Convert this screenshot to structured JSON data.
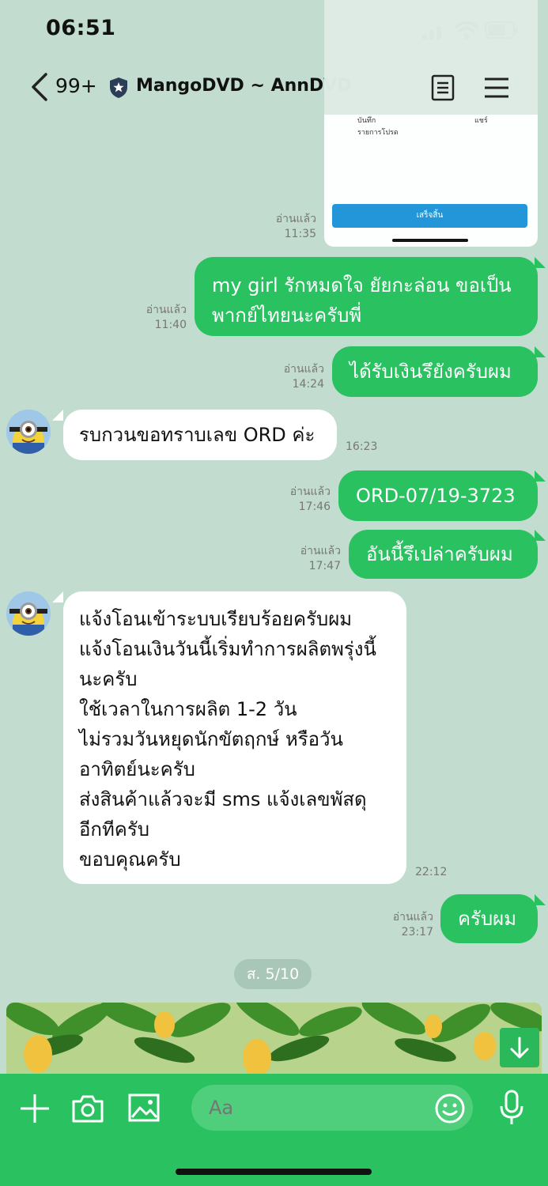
{
  "status_bar": {
    "time": "06:51"
  },
  "header": {
    "back_count": "99+",
    "chat_title": "MangoDVD ~ AnnDVD"
  },
  "shared_image": {
    "label_a": "บันทึก",
    "label_b": "แชร์",
    "label_c": "รายการโปรด",
    "button": "เสร็จสิ้น"
  },
  "messages": [
    {
      "dir": "out",
      "read": "อ่านแล้ว",
      "time": "11:35"
    },
    {
      "dir": "out",
      "read": "อ่านแล้ว",
      "time": "11:40",
      "lines": [
        "my girl รักหมดใจ ยัยกะล่อน ขอเป็น",
        "พากย์ไทยนะครับพี่"
      ]
    },
    {
      "dir": "out",
      "read": "อ่านแล้ว",
      "time": "14:24",
      "lines": [
        "ได้รับเงินรึยังครับผม"
      ]
    },
    {
      "dir": "in",
      "time": "16:23",
      "lines": [
        "รบกวนขอทราบเลข ORD ค่ะ"
      ]
    },
    {
      "dir": "out",
      "read": "อ่านแล้ว",
      "time": "17:46",
      "lines": [
        "ORD-07/19-3723"
      ]
    },
    {
      "dir": "out",
      "read": "อ่านแล้ว",
      "time": "17:47",
      "lines": [
        "อันนี้รึเปล่าครับผม"
      ]
    },
    {
      "dir": "in",
      "time": "22:12",
      "lines": [
        "แจ้งโอนเข้าระบบเรียบร้อยครับผม",
        "แจ้งโอนเงินวันนี้เริ่มทำการผลิตพรุ่งนี้",
        "นะครับ",
        "ใช้เวลาในการผลิต 1-2 วัน",
        "ไม่รวมวันหยุดนักขัตฤกษ์ หรือวัน",
        "อาทิตย์นะครับ",
        "ส่งสินค้าแล้วจะมี sms แจ้งเลขพัสดุ",
        "อีกทีครับ",
        "ขอบคุณครับ"
      ]
    },
    {
      "dir": "out",
      "read": "อ่านแล้ว",
      "time": "23:17",
      "lines": [
        "ครับผม"
      ]
    }
  ],
  "date_separator": "ส. 5/10",
  "composer": {
    "placeholder": "Aa"
  },
  "icons": [
    "signal-icon",
    "wifi-icon",
    "battery-icon",
    "back-icon",
    "shield-icon",
    "notes-icon",
    "menu-icon",
    "scroll-down-icon",
    "plus-icon",
    "camera-icon",
    "image-icon",
    "emoji-icon",
    "mic-icon"
  ],
  "colors": {
    "bg": "#c2dccf",
    "bubble_out": "#2ac161",
    "bubble_in": "#ffffff",
    "composer": "#2ac161"
  }
}
